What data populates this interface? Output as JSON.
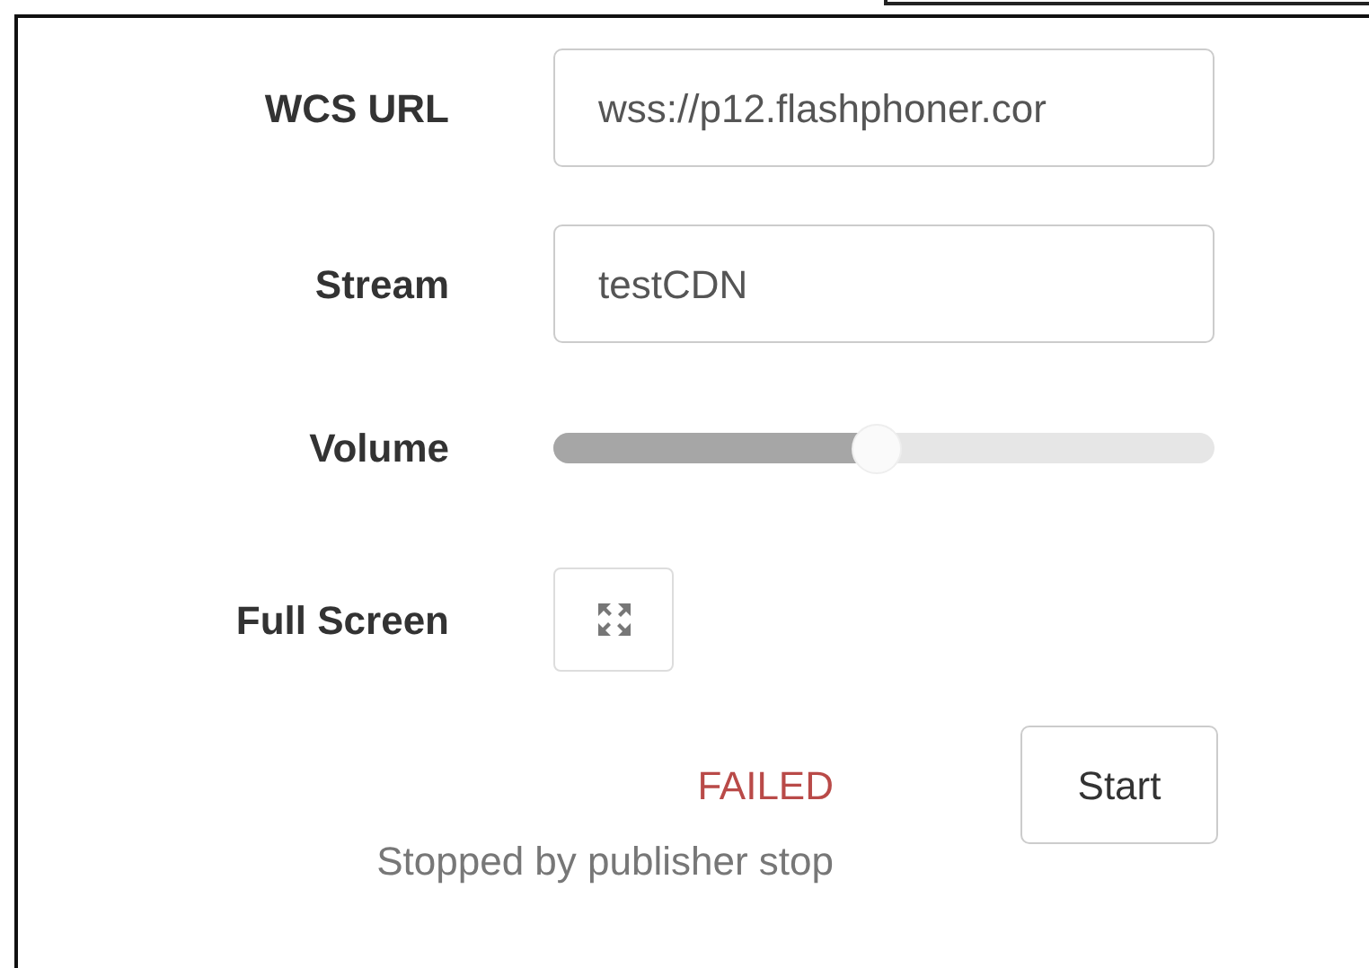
{
  "fields": [
    {
      "label": "WCS URL",
      "value": "wss://p12.flashphoner.cor"
    },
    {
      "label": "Stream",
      "value": "testCDN"
    }
  ],
  "volume": {
    "label": "Volume",
    "level": 0.49
  },
  "full_screen": {
    "label": "Full Screen"
  },
  "status": {
    "state": "FAILED",
    "message": "Stopped by publisher stop"
  },
  "start_button": "Start"
}
